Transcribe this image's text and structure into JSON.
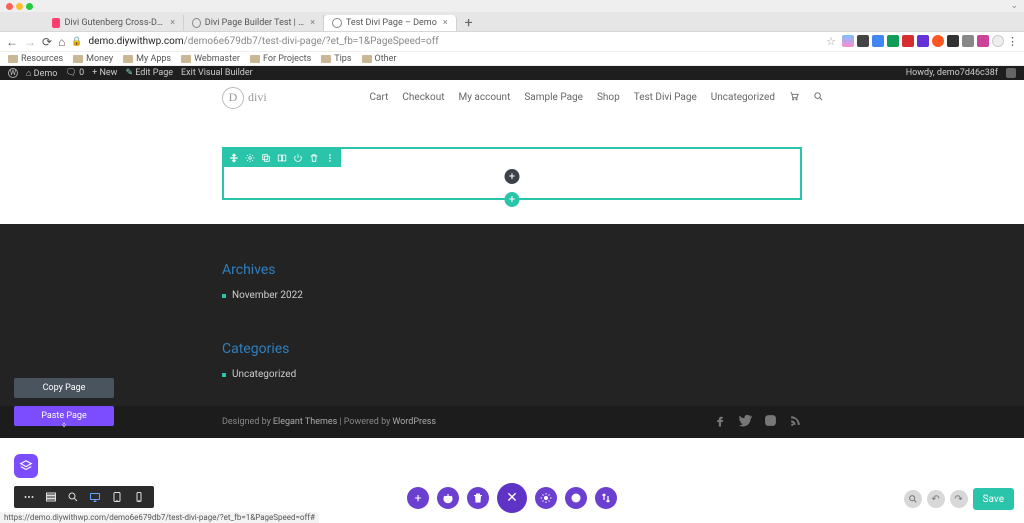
{
  "browser": {
    "tabs": [
      {
        "title": "Divi Gutenberg Cross-Domain"
      },
      {
        "title": "Divi Page Builder Test | Demo"
      },
      {
        "title": "Test Divi Page – Demo"
      }
    ],
    "url_domain": "demo.diywithwp.com",
    "url_path": "/demo6e679db7/test-divi-page/?et_fb=1&PageSpeed=off",
    "bookmarks": [
      "Resources",
      "Money",
      "My Apps",
      "Webmaster",
      "For Projects",
      "Tips",
      "Other"
    ]
  },
  "adminbar": {
    "site": "Demo",
    "comments": "0",
    "new": "New",
    "edit": "Edit Page",
    "exit_vb": "Exit Visual Builder",
    "howdy": "Howdy, demo7d46c38f"
  },
  "site": {
    "logo_text": "divi",
    "logo_letter": "D",
    "menu": [
      "Cart",
      "Checkout",
      "My account",
      "Sample Page",
      "Shop",
      "Test Divi Page",
      "Uncategorized"
    ]
  },
  "footer": {
    "archives_title": "Archives",
    "archives_items": [
      "November 2022"
    ],
    "categories_title": "Categories",
    "categories_items": [
      "Uncategorized"
    ],
    "credit_prefix": "Designed by ",
    "credit_theme": "Elegant Themes",
    "credit_sep": " | Powered by ",
    "credit_platform": "WordPress"
  },
  "page_actions": {
    "copy": "Copy Page",
    "paste": "Paste Page"
  },
  "bottom": {
    "save": "Save"
  },
  "status_url": "https://demo.diywithwp.com/demo6e679db7/test-divi-page/?et_fb=1&PageSpeed=off#"
}
